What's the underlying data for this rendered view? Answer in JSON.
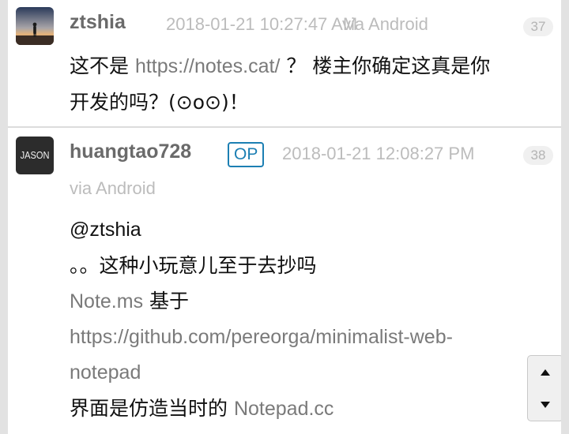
{
  "replies": [
    {
      "username": "ztshia",
      "date": "2018-01-21 10:27:47 AM",
      "via": "via Android",
      "floor": "37",
      "content": {
        "part1": "这不是 ",
        "link": "https://notes.cat/",
        "part2": " ？ 楼主你确定这真是你",
        "line2": "开发的吗？(⊙o⊙)！"
      }
    },
    {
      "username": "huangtao728",
      "badge": "OP",
      "date": "2018-01-21 12:08:27 PM",
      "via": "via Android",
      "floor": "38",
      "avatar_text": "JASON",
      "content": {
        "mention": "@ztshia",
        "line2": "。。这种小玩意儿至于去抄吗",
        "line3_link": "Note.ms",
        "line3_text": " 基于",
        "line4_link": "https://github.com/pereorga/minimalist-web-",
        "line5_link": "notepad",
        "line6_text": "界面是仿造当时的 ",
        "line6_link": "Notepad.cc"
      }
    }
  ],
  "icons": {
    "scroll_up": "triangle-up",
    "scroll_down": "triangle-down"
  },
  "colors": {
    "username": "#6a6a6a",
    "meta": "#bcbcbc",
    "link": "#7a7a7a",
    "op_badge": "#1c7fb3",
    "background": "#e2e2e2"
  }
}
